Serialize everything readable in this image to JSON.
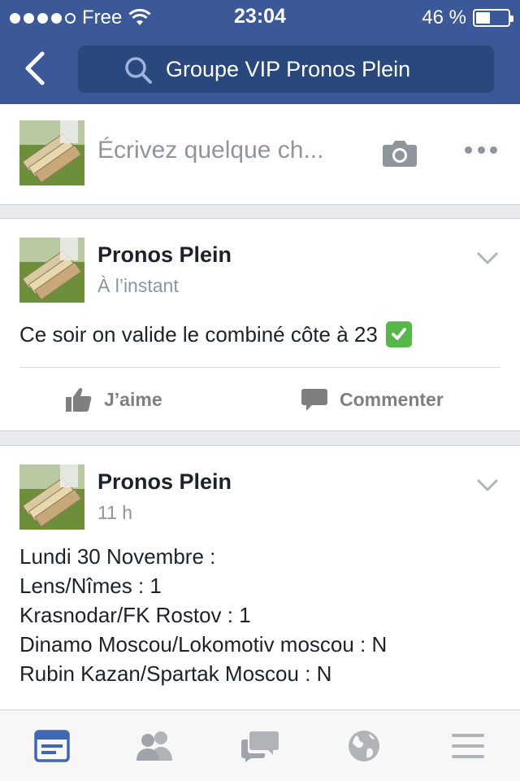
{
  "status_bar": {
    "carrier": "Free",
    "time": "23:04",
    "battery_text": "46 %",
    "battery_level": 0.46
  },
  "header": {
    "search_text": "Groupe VIP Pronos Plein"
  },
  "composer": {
    "placeholder": "Écrivez quelque ch..."
  },
  "posts": [
    {
      "author": "Pronos Plein",
      "time": "À l’instant",
      "text": "Ce soir on valide le combiné côte à 23",
      "emoji": "white-heavy-check-mark",
      "like_label": "J’aime",
      "comment_label": "Commenter"
    },
    {
      "author": "Pronos Plein",
      "time": "11 h",
      "lines": [
        "Lundi 30 Novembre :",
        "Lens/Nîmes : 1",
        "Krasnodar/FK Rostov : 1",
        "Dinamo Moscou/Lokomotiv moscou : N",
        "Rubin Kazan/Spartak Moscou : N"
      ]
    }
  ],
  "tabbar": {
    "items": [
      "news-feed-icon",
      "friends-icon",
      "messages-icon",
      "globe-icon",
      "menu-icon"
    ],
    "active_color": "#4267b2",
    "inactive_color": "#90949c"
  },
  "colors": {
    "brand": "#3b5998",
    "search_bg": "#29487d"
  }
}
